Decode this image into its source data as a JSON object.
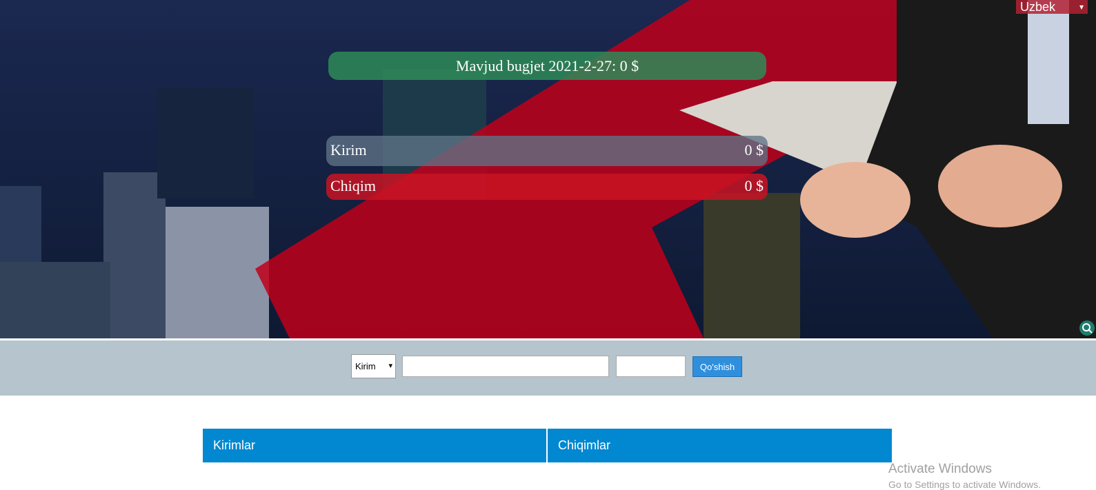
{
  "language": {
    "selected": "Uzbek"
  },
  "budget": {
    "text": "Mavjud bugjet 2021-2-27: 0 $"
  },
  "summary": {
    "income": {
      "label": "Kirim",
      "value": "0 $"
    },
    "expense": {
      "label": "Chiqim",
      "value": "0 $"
    }
  },
  "form": {
    "type_selected": "Kirim",
    "description_value": "",
    "amount_value": "",
    "submit_label": "Qo'shish"
  },
  "lists": {
    "income_header": "Kirimlar",
    "expense_header": "Chiqimlar"
  },
  "watermark": {
    "title": "Activate Windows",
    "subtitle": "Go to Settings to activate Windows."
  },
  "colors": {
    "budget_bar": "#2e8b57",
    "income_bar": "#5f7387",
    "expense_bar": "#c81423",
    "strip": "#b6c4cd",
    "button": "#2f8fdc",
    "list_header": "#0288d1"
  }
}
